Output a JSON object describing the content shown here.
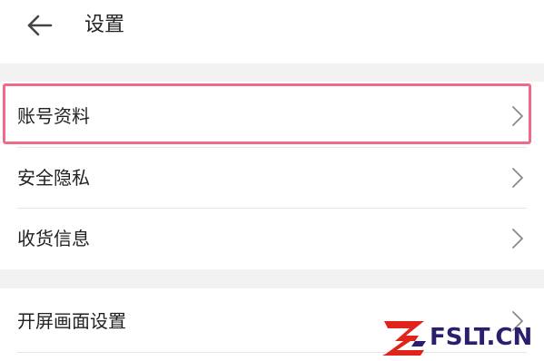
{
  "header": {
    "title": "设置",
    "back_icon": "arrow-left-icon"
  },
  "groups": [
    {
      "items": [
        {
          "label": "账号资料",
          "highlighted": true
        },
        {
          "label": "安全隐私",
          "highlighted": false
        },
        {
          "label": "收货信息",
          "highlighted": false
        }
      ]
    },
    {
      "items": [
        {
          "label": "开屏画面设置",
          "highlighted": false
        }
      ]
    }
  ],
  "watermark": {
    "text": "FSLT.CN"
  },
  "colors": {
    "highlight": "#f06a8a",
    "background": "#f2f2f2",
    "card": "#ffffff",
    "text": "#222222",
    "chevron": "#8a8a8a",
    "watermark_red": "#e0241b",
    "watermark_navy": "#2a1f6e"
  }
}
